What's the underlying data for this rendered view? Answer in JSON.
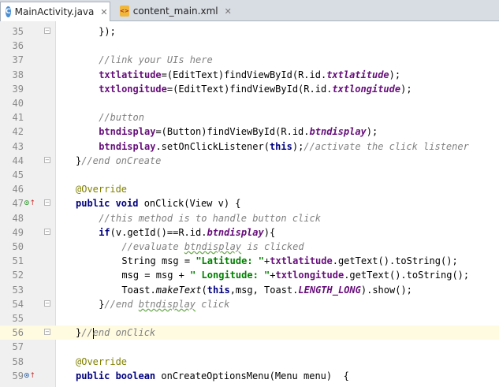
{
  "tabs": [
    {
      "label": "MainActivity.java",
      "icon": "C",
      "active": true
    },
    {
      "label": "content_main.xml",
      "icon": "xml",
      "active": false
    }
  ],
  "lines": [
    {
      "n": "35",
      "indent": 4,
      "tokens": [
        [
          "p",
          "});"
        ]
      ]
    },
    {
      "n": "36",
      "indent": 0,
      "tokens": []
    },
    {
      "n": "37",
      "indent": 4,
      "tokens": [
        [
          "cm",
          "//link your UIs here"
        ]
      ]
    },
    {
      "n": "38",
      "indent": 4,
      "tokens": [
        [
          "var",
          "txtlatitude"
        ],
        [
          "p",
          "=(EditText)findViewById(R.id."
        ],
        [
          "fld",
          "txtlatitude"
        ],
        [
          "p",
          ");"
        ]
      ]
    },
    {
      "n": "39",
      "indent": 4,
      "tokens": [
        [
          "var",
          "txtlongitude"
        ],
        [
          "p",
          "=(EditText)findViewById(R.id."
        ],
        [
          "fld",
          "txtlongitude"
        ],
        [
          "p",
          ");"
        ]
      ]
    },
    {
      "n": "40",
      "indent": 0,
      "tokens": []
    },
    {
      "n": "41",
      "indent": 4,
      "tokens": [
        [
          "cm",
          "//button"
        ]
      ]
    },
    {
      "n": "42",
      "indent": 4,
      "tokens": [
        [
          "var",
          "btndisplay"
        ],
        [
          "p",
          "=(Button)findViewById(R.id."
        ],
        [
          "fld",
          "btndisplay"
        ],
        [
          "p",
          ");"
        ]
      ]
    },
    {
      "n": "43",
      "indent": 4,
      "tokens": [
        [
          "var",
          "btndisplay"
        ],
        [
          "p",
          ".setOnClickListener("
        ],
        [
          "kw",
          "this"
        ],
        [
          "p",
          ");"
        ],
        [
          "cm",
          "//activate the click listener"
        ]
      ]
    },
    {
      "n": "44",
      "indent": 2,
      "tokens": [
        [
          "p",
          "}"
        ],
        [
          "cm",
          "//end onCreate"
        ]
      ]
    },
    {
      "n": "45",
      "indent": 0,
      "tokens": []
    },
    {
      "n": "46",
      "indent": 2,
      "tokens": [
        [
          "ann",
          "@Override"
        ]
      ]
    },
    {
      "n": "47",
      "indent": 2,
      "mark": "override",
      "tokens": [
        [
          "kw",
          "public void "
        ],
        [
          "p",
          "onClick(View v) {"
        ]
      ]
    },
    {
      "n": "48",
      "indent": 4,
      "tokens": [
        [
          "cm",
          "//this method is to handle button click"
        ]
      ]
    },
    {
      "n": "49",
      "indent": 4,
      "tokens": [
        [
          "kw",
          "if"
        ],
        [
          "p",
          "(v.getId()==R.id."
        ],
        [
          "fld",
          "btndisplay"
        ],
        [
          "p",
          "){"
        ]
      ]
    },
    {
      "n": "50",
      "indent": 6,
      "tokens": [
        [
          "cm",
          "//evaluate "
        ],
        [
          "cmw",
          "btndisplay"
        ],
        [
          "cm",
          " is clicked"
        ]
      ]
    },
    {
      "n": "51",
      "indent": 6,
      "tokens": [
        [
          "p",
          "String msg = "
        ],
        [
          "str",
          "\"Latitude: \""
        ],
        [
          "p",
          "+"
        ],
        [
          "var",
          "txtlatitude"
        ],
        [
          "p",
          ".getText().toString();"
        ]
      ]
    },
    {
      "n": "52",
      "indent": 6,
      "tokens": [
        [
          "p",
          "msg = msg + "
        ],
        [
          "str",
          "\" Longitude: \""
        ],
        [
          "p",
          "+"
        ],
        [
          "var",
          "txtlongitude"
        ],
        [
          "p",
          ".getText().toString();"
        ]
      ]
    },
    {
      "n": "53",
      "indent": 6,
      "tokens": [
        [
          "p",
          "Toast."
        ],
        [
          "sm",
          "makeText"
        ],
        [
          "p",
          "("
        ],
        [
          "kw",
          "this"
        ],
        [
          "p",
          ",msg, Toast."
        ],
        [
          "fld",
          "LENGTH_LONG"
        ],
        [
          "p",
          ").show();"
        ]
      ]
    },
    {
      "n": "54",
      "indent": 4,
      "tokens": [
        [
          "p",
          "}"
        ],
        [
          "cm",
          "//end "
        ],
        [
          "cmw",
          "btndisplay"
        ],
        [
          "cm",
          " click"
        ]
      ]
    },
    {
      "n": "55",
      "indent": 0,
      "tokens": []
    },
    {
      "n": "56",
      "indent": 2,
      "current": true,
      "tokens": [
        [
          "p",
          "}"
        ],
        [
          "cm",
          "//"
        ],
        [
          "caret",
          ""
        ],
        [
          "cm",
          "end onClick"
        ]
      ]
    },
    {
      "n": "57",
      "indent": 0,
      "tokens": []
    },
    {
      "n": "58",
      "indent": 2,
      "tokens": [
        [
          "ann",
          "@Override"
        ]
      ]
    },
    {
      "n": "59",
      "indent": 2,
      "mark": "override-c",
      "tokens": [
        [
          "kw",
          "public boolean "
        ],
        [
          "p",
          "onCreateOptionsMenu(Menu menu)  {"
        ]
      ]
    }
  ],
  "fold_lines": [
    "35",
    "44",
    "47",
    "49",
    "54",
    "56"
  ],
  "colors": {
    "keyword": "#000080",
    "comment": "#808080",
    "string": "#008000",
    "field": "#660e7a",
    "annotation": "#808000",
    "current_line": "#fffbe1"
  }
}
